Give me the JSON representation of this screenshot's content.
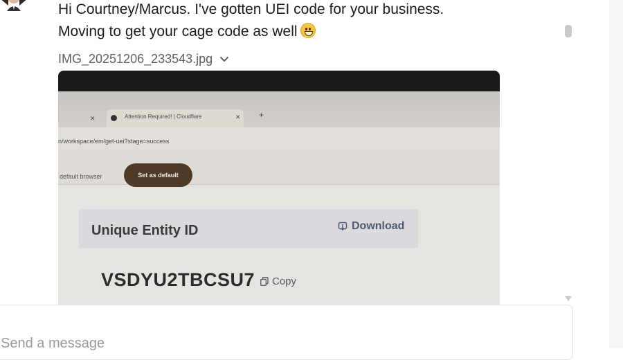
{
  "message": {
    "line1": "Hi Courtney/Marcus. I've gotten UEI code for your business.",
    "line2": "Moving to get your cage code as well",
    "emoji": "grinning-face"
  },
  "attachment": {
    "file_name": "IMG_20251206_233543.jpg",
    "photo": {
      "tab_title": "Attention Required! | Cloudflare",
      "url_text": "n/workspace/em/get-uei?stage=success",
      "banner_text": "default browser",
      "set_default_label": "Set as default",
      "uei_label": "Unique Entity ID",
      "download_label": "Download",
      "uei_value": "VSDYU2TBCSU7",
      "copy_label": "Copy"
    }
  },
  "composer": {
    "placeholder": "Send a message"
  },
  "colors": {
    "text": "#1d1c1d",
    "muted": "#616061",
    "set_default_bg": "#4e3a27"
  }
}
